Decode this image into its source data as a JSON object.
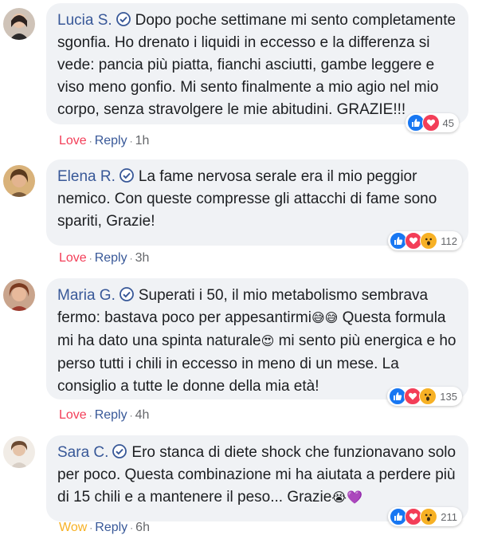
{
  "comments": [
    {
      "author": "Lucia S.",
      "text": "Dopo poche settimane mi sento completamente sgonfia. Ho drenato i liquidi in eccesso e la differenza si vede: pancia più piatta, fianchi asciutti, gambe leggere e viso meno gonfio. Mi sento finalmente a mio agio nel mio corpo, senza stravolgere le mie abitudini. GRAZIE!!!",
      "reaction_count": "45",
      "reaction_label": "Love",
      "reply_label": "Reply",
      "time": "1h"
    },
    {
      "author": "Elena R.",
      "text": "La fame nervosa serale era il mio peggior nemico. Con queste compresse gli attacchi di fame sono spariti, Grazie!",
      "reaction_count": "112",
      "reaction_label": "Love",
      "reply_label": "Reply",
      "time": "3h"
    },
    {
      "author": "Maria G.",
      "text_part1": "Superati i 50, il mio metabolismo sembrava fermo: bastava poco per appesantirmi",
      "emoji1": "😅😅",
      "text_part2": " Questa formula mi ha dato una spinta naturale",
      "emoji2": "😍",
      "text_part3": " mi sento più energica e ho perso tutti i chili in eccesso in meno di un mese. La consiglio a tutte le donne della mia età!",
      "reaction_count": "135",
      "reaction_label": "Love",
      "reply_label": "Reply",
      "time": "4h"
    },
    {
      "author": "Sara C.",
      "text": "Ero stanca di diete shock che funzionavano solo per poco. Questa combinazione mi ha aiutata a perdere più di 15 chili e a mantenere il peso... Grazie",
      "emoji": "😭💜",
      "reaction_count": "211",
      "reaction_label": "Wow",
      "reply_label": "Reply",
      "time": "6h"
    }
  ],
  "colors": {
    "author": "#385898",
    "like": "#1877f2",
    "love": "#f33e58",
    "wow": "#f7b125",
    "bubble": "#f0f2f5"
  }
}
